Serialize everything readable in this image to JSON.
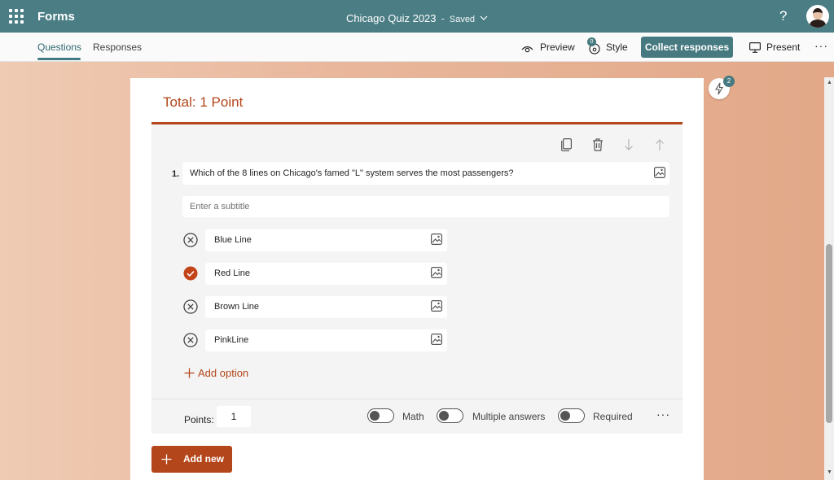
{
  "topbar": {
    "app_name": "Forms",
    "doc_title": "Chicago Quiz 2023",
    "separator": "-",
    "save_status": "Saved",
    "help": "?"
  },
  "commandbar": {
    "tabs": [
      {
        "label": "Questions",
        "active": true
      },
      {
        "label": "Responses",
        "active": false
      }
    ],
    "preview_label": "Preview",
    "style_label": "Style",
    "style_badge": "0",
    "collect_label": "Collect responses",
    "present_label": "Present",
    "more": "···"
  },
  "form": {
    "total": "Total: 1 Point",
    "question": {
      "number": "1.",
      "text": "Which of the 8 lines on Chicago's famed \"L\" system serves the most passengers?",
      "subtitle_placeholder": "Enter a subtitle",
      "options": [
        {
          "label": "Blue Line",
          "correct": false
        },
        {
          "label": "Red Line",
          "correct": true
        },
        {
          "label": "Brown Line",
          "correct": false
        },
        {
          "label": "PinkLine",
          "correct": false
        }
      ],
      "add_option": "Add option",
      "points_label": "Points:",
      "points_value": "1",
      "toggles": [
        {
          "label": "Math",
          "on": false
        },
        {
          "label": "Multiple answers",
          "on": false
        },
        {
          "label": "Required",
          "on": false
        }
      ],
      "more": "···"
    },
    "add_new": "Add new"
  },
  "ideas_badge": "2",
  "colors": {
    "header": "#4a7d84",
    "accent": "#b3461a",
    "correct": "#c4441a"
  },
  "icons": [
    "waffle-icon",
    "chevron-down-icon",
    "eye-icon",
    "palette-icon",
    "monitor-icon",
    "copy-icon",
    "trash-icon",
    "arrow-down-icon",
    "arrow-up-icon",
    "image-icon",
    "close-circle-icon",
    "check-circle-icon",
    "plus-icon",
    "lightning-icon"
  ]
}
